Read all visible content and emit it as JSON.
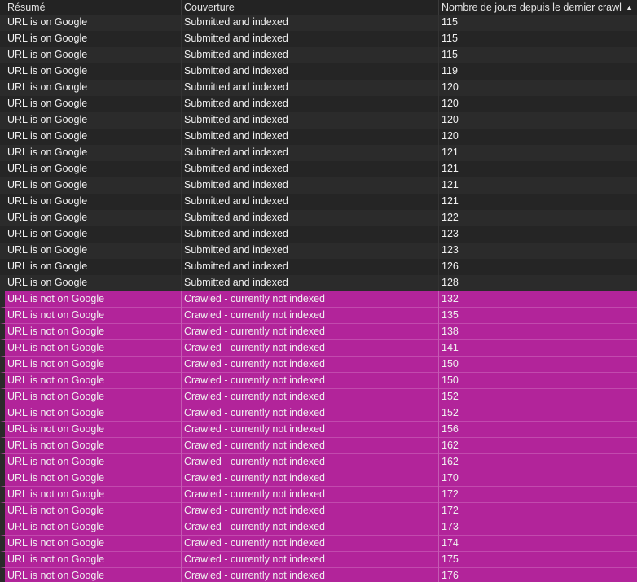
{
  "colors": {
    "background": "#1f1f1f",
    "row_dark": "#2b2b2b",
    "row_dark_alt": "#252525",
    "row_highlight": "#b2249a",
    "text": "#f0f0f0"
  },
  "table": {
    "columns": [
      {
        "label": "Résumé"
      },
      {
        "label": "Couverture"
      },
      {
        "label": "Nombre de jours depuis le dernier crawl",
        "sort": "ascending",
        "sort_icon": "triangle-up-icon"
      }
    ],
    "rows": [
      {
        "summary": "URL is on Google",
        "coverage": "Submitted and indexed",
        "days": "115",
        "highlight": false
      },
      {
        "summary": "URL is on Google",
        "coverage": "Submitted and indexed",
        "days": "115",
        "highlight": false
      },
      {
        "summary": "URL is on Google",
        "coverage": "Submitted and indexed",
        "days": "115",
        "highlight": false
      },
      {
        "summary": "URL is on Google",
        "coverage": "Submitted and indexed",
        "days": "119",
        "highlight": false
      },
      {
        "summary": "URL is on Google",
        "coverage": "Submitted and indexed",
        "days": "120",
        "highlight": false
      },
      {
        "summary": "URL is on Google",
        "coverage": "Submitted and indexed",
        "days": "120",
        "highlight": false
      },
      {
        "summary": "URL is on Google",
        "coverage": "Submitted and indexed",
        "days": "120",
        "highlight": false
      },
      {
        "summary": "URL is on Google",
        "coverage": "Submitted and indexed",
        "days": "120",
        "highlight": false
      },
      {
        "summary": "URL is on Google",
        "coverage": "Submitted and indexed",
        "days": "121",
        "highlight": false
      },
      {
        "summary": "URL is on Google",
        "coverage": "Submitted and indexed",
        "days": "121",
        "highlight": false
      },
      {
        "summary": "URL is on Google",
        "coverage": "Submitted and indexed",
        "days": "121",
        "highlight": false
      },
      {
        "summary": "URL is on Google",
        "coverage": "Submitted and indexed",
        "days": "121",
        "highlight": false
      },
      {
        "summary": "URL is on Google",
        "coverage": "Submitted and indexed",
        "days": "122",
        "highlight": false
      },
      {
        "summary": "URL is on Google",
        "coverage": "Submitted and indexed",
        "days": "123",
        "highlight": false
      },
      {
        "summary": "URL is on Google",
        "coverage": "Submitted and indexed",
        "days": "123",
        "highlight": false
      },
      {
        "summary": "URL is on Google",
        "coverage": "Submitted and indexed",
        "days": "126",
        "highlight": false
      },
      {
        "summary": "URL is on Google",
        "coverage": "Submitted and indexed",
        "days": "128",
        "highlight": false
      },
      {
        "summary": "URL is not on Google",
        "coverage": "Crawled - currently not indexed",
        "days": "132",
        "highlight": true
      },
      {
        "summary": "URL is not on Google",
        "coverage": "Crawled - currently not indexed",
        "days": "135",
        "highlight": true
      },
      {
        "summary": "URL is not on Google",
        "coverage": "Crawled - currently not indexed",
        "days": "138",
        "highlight": true
      },
      {
        "summary": "URL is not on Google",
        "coverage": "Crawled - currently not indexed",
        "days": "141",
        "highlight": true
      },
      {
        "summary": "URL is not on Google",
        "coverage": "Crawled - currently not indexed",
        "days": "150",
        "highlight": true
      },
      {
        "summary": "URL is not on Google",
        "coverage": "Crawled - currently not indexed",
        "days": "150",
        "highlight": true
      },
      {
        "summary": "URL is not on Google",
        "coverage": "Crawled - currently not indexed",
        "days": "152",
        "highlight": true
      },
      {
        "summary": "URL is not on Google",
        "coverage": "Crawled - currently not indexed",
        "days": "152",
        "highlight": true
      },
      {
        "summary": "URL is not on Google",
        "coverage": "Crawled - currently not indexed",
        "days": "156",
        "highlight": true
      },
      {
        "summary": "URL is not on Google",
        "coverage": "Crawled - currently not indexed",
        "days": "162",
        "highlight": true
      },
      {
        "summary": "URL is not on Google",
        "coverage": "Crawled - currently not indexed",
        "days": "162",
        "highlight": true
      },
      {
        "summary": "URL is not on Google",
        "coverage": "Crawled - currently not indexed",
        "days": "170",
        "highlight": true
      },
      {
        "summary": "URL is not on Google",
        "coverage": "Crawled - currently not indexed",
        "days": "172",
        "highlight": true
      },
      {
        "summary": "URL is not on Google",
        "coverage": "Crawled - currently not indexed",
        "days": "172",
        "highlight": true
      },
      {
        "summary": "URL is not on Google",
        "coverage": "Crawled - currently not indexed",
        "days": "173",
        "highlight": true
      },
      {
        "summary": "URL is not on Google",
        "coverage": "Crawled - currently not indexed",
        "days": "174",
        "highlight": true
      },
      {
        "summary": "URL is not on Google",
        "coverage": "Crawled - currently not indexed",
        "days": "175",
        "highlight": true
      },
      {
        "summary": "URL is not on Google",
        "coverage": "Crawled - currently not indexed",
        "days": "176",
        "highlight": true
      }
    ]
  }
}
